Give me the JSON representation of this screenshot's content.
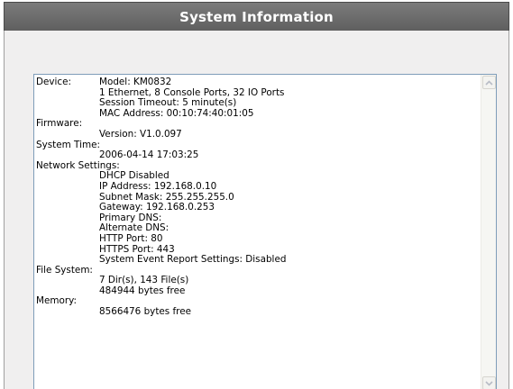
{
  "window": {
    "title": "System Information"
  },
  "info": {
    "lines": [
      {
        "label": "Device:",
        "value": "Model: KM0832"
      },
      {
        "label": "",
        "value": "1 Ethernet, 8 Console Ports, 32 IO Ports"
      },
      {
        "label": "",
        "value": "Session Timeout:  5 minute(s)"
      },
      {
        "label": "",
        "value": "MAC Address:  00:10:74:40:01:05"
      },
      {
        "label": "Firmware:",
        "value": ""
      },
      {
        "label": "",
        "value": "Version:  V1.0.097"
      },
      {
        "label": "System Time:",
        "value": ""
      },
      {
        "label": "",
        "value": "2006-04-14 17:03:25"
      },
      {
        "label": "Network Settings:",
        "value": ""
      },
      {
        "label": "",
        "value": "DHCP Disabled"
      },
      {
        "label": "",
        "value": "IP Address:  192.168.0.10"
      },
      {
        "label": "",
        "value": "Subnet Mask:  255.255.255.0"
      },
      {
        "label": "",
        "value": "Gateway:  192.168.0.253"
      },
      {
        "label": "",
        "value": "Primary DNS:"
      },
      {
        "label": "",
        "value": "Alternate DNS:"
      },
      {
        "label": "",
        "value": "HTTP Port:  80"
      },
      {
        "label": "",
        "value": "HTTPS Port:  443"
      },
      {
        "label": "",
        "value": "System Event Report Settings:  Disabled"
      },
      {
        "label": "File System:",
        "value": ""
      },
      {
        "label": "",
        "value": "7 Dir(s), 143 File(s)"
      },
      {
        "label": "",
        "value": "484944 bytes free"
      },
      {
        "label": "Memory:",
        "value": ""
      },
      {
        "label": "",
        "value": "8566476 bytes free"
      }
    ]
  },
  "icons": {
    "scroll_up": "arrow-up-icon",
    "scroll_down": "arrow-down-icon",
    "scroll_left": "arrow-left-icon",
    "scroll_right": "arrow-right-icon"
  },
  "colors": {
    "title_bar": "#6e6e6e",
    "panel": "#f0efef",
    "textarea_border": "#7f9db9"
  }
}
